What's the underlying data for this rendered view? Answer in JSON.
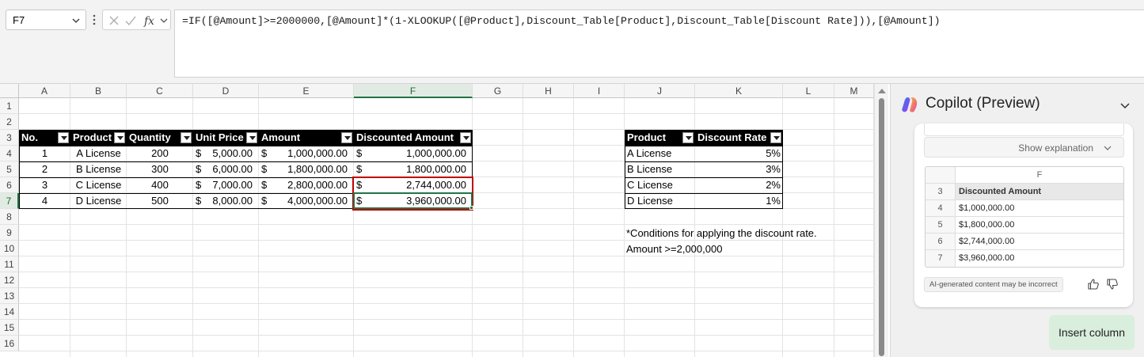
{
  "formula_bar": {
    "name_box": "F7",
    "formula": "=IF([@Amount]>=2000000,[@Amount]*(1-XLOOKUP([@Product],Discount_Table[Product],Discount_Table[Discount Rate])),[@Amount])"
  },
  "grid": {
    "columns": [
      "A",
      "B",
      "C",
      "D",
      "E",
      "F",
      "G",
      "H",
      "I",
      "J",
      "K",
      "L",
      "M"
    ],
    "rows": [
      "1",
      "2",
      "3",
      "4",
      "5",
      "6",
      "7",
      "8",
      "9",
      "10",
      "11",
      "12",
      "13",
      "14",
      "15",
      "16"
    ],
    "selected_column": "F",
    "selected_row": "7"
  },
  "main_table": {
    "headers": [
      "No.",
      "Product",
      "Quantity",
      "Unit Price",
      "Amount",
      "Discounted Amount"
    ],
    "currency_symbol": "$",
    "rows": [
      {
        "no": "1",
        "product": "A License",
        "qty": "200",
        "unit_price": "5,000.00",
        "amount": "1,000,000.00",
        "discounted": "1,000,000.00"
      },
      {
        "no": "2",
        "product": "B License",
        "qty": "300",
        "unit_price": "6,000.00",
        "amount": "1,800,000.00",
        "discounted": "1,800,000.00"
      },
      {
        "no": "3",
        "product": "C License",
        "qty": "400",
        "unit_price": "7,000.00",
        "amount": "2,800,000.00",
        "discounted": "2,744,000.00"
      },
      {
        "no": "4",
        "product": "D License",
        "qty": "500",
        "unit_price": "8,000.00",
        "amount": "4,000,000.00",
        "discounted": "3,960,000.00"
      }
    ]
  },
  "discount_table": {
    "headers": [
      "Product",
      "Discount Rate"
    ],
    "rows": [
      {
        "product": "A License",
        "rate": "5%"
      },
      {
        "product": "B License",
        "rate": "3%"
      },
      {
        "product": "C License",
        "rate": "2%"
      },
      {
        "product": "D License",
        "rate": "1%"
      }
    ]
  },
  "notes": {
    "line1": "*Conditions for applying the discount rate.",
    "line2": "Amount >=2,000,000"
  },
  "copilot": {
    "title": "Copilot (Preview)",
    "show_explanation": "Show explanation",
    "preview_table": {
      "column_letter": "F",
      "rows": [
        {
          "num": "3",
          "value": "Discounted Amount"
        },
        {
          "num": "4",
          "value": "$1,000,000.00"
        },
        {
          "num": "5",
          "value": "$1,800,000.00"
        },
        {
          "num": "6",
          "value": "$2,744,000.00"
        },
        {
          "num": "7",
          "value": "$3,960,000.00"
        }
      ]
    },
    "disclaimer": "AI-generated content may be incorrect",
    "insert_button": "Insert column"
  },
  "colors": {
    "accent_green": "#217346",
    "selection_red": "#c00000",
    "insert_button_bg": "#d9eedd"
  }
}
